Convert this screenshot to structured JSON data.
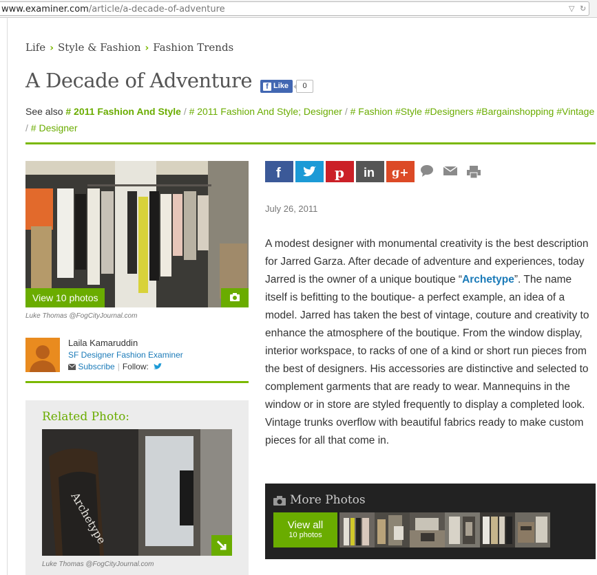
{
  "browser": {
    "url_host": "www.examiner.com",
    "url_path": "/article/a-decade-of-adventure"
  },
  "breadcrumb": [
    "Life",
    "Style & Fashion",
    "Fashion Trends"
  ],
  "article": {
    "title": "A Decade of Adventure",
    "fb_like_label": "Like",
    "fb_like_count": "0",
    "date": "July 26, 2011",
    "body_part1": "A modest designer with monumental creativity is the best description for Jarred Garza. After decade of adventure and experiences, today Jarred is the owner of a unique boutique “",
    "body_link": "Archetype",
    "body_part2": "”. The name itself is befitting to the boutique- a perfect example, an idea of a model. Jarred has taken the best of vintage, couture and creativity to enhance the atmosphere of the boutique. From the window display, interior workspace, to racks of one of a kind or short run pieces from the best of designers. His accessories are distinctive and selected to complement garments that are ready to wear. Mannequins in the window or in store are styled frequently to display a completed look. Vintage trunks overflow with beautiful fabrics ready to make custom pieces for all that come in."
  },
  "see_also": {
    "label": "See also",
    "tags": [
      "# 2011 Fashion And Style",
      "# 2011 Fashion And Style; Designer",
      "# Fashion #Style #Designers #Bargainshopping #Vintage",
      "# Designer"
    ]
  },
  "main_photo": {
    "button_label": "View 10 photos",
    "credit": "Luke Thomas @FogCityJournal.com"
  },
  "author": {
    "name": "Laila Kamaruddin",
    "role": "SF Designer Fashion Examiner",
    "subscribe_label": "Subscribe",
    "follow_label": "Follow:"
  },
  "related": {
    "heading": "Related Photo:",
    "credit": "Luke Thomas @FogCityJournal.com"
  },
  "more_photos": {
    "heading": "More Photos",
    "view_all": "View all",
    "count_label": "10 photos"
  },
  "colors": {
    "accent_green": "#7ab800",
    "link_blue": "#1a7ab8",
    "facebook": "#3b5998",
    "twitter": "#1c9ad6",
    "pinterest": "#cb2027",
    "linkedin": "#555555",
    "googleplus": "#dc4a26"
  },
  "icons": [
    "facebook-icon",
    "twitter-icon",
    "pinterest-icon",
    "linkedin-icon",
    "google-plus-icon",
    "comment-icon",
    "email-icon",
    "print-icon",
    "camera-icon",
    "expand-icon",
    "mail-icon",
    "twitter-follow-icon"
  ]
}
